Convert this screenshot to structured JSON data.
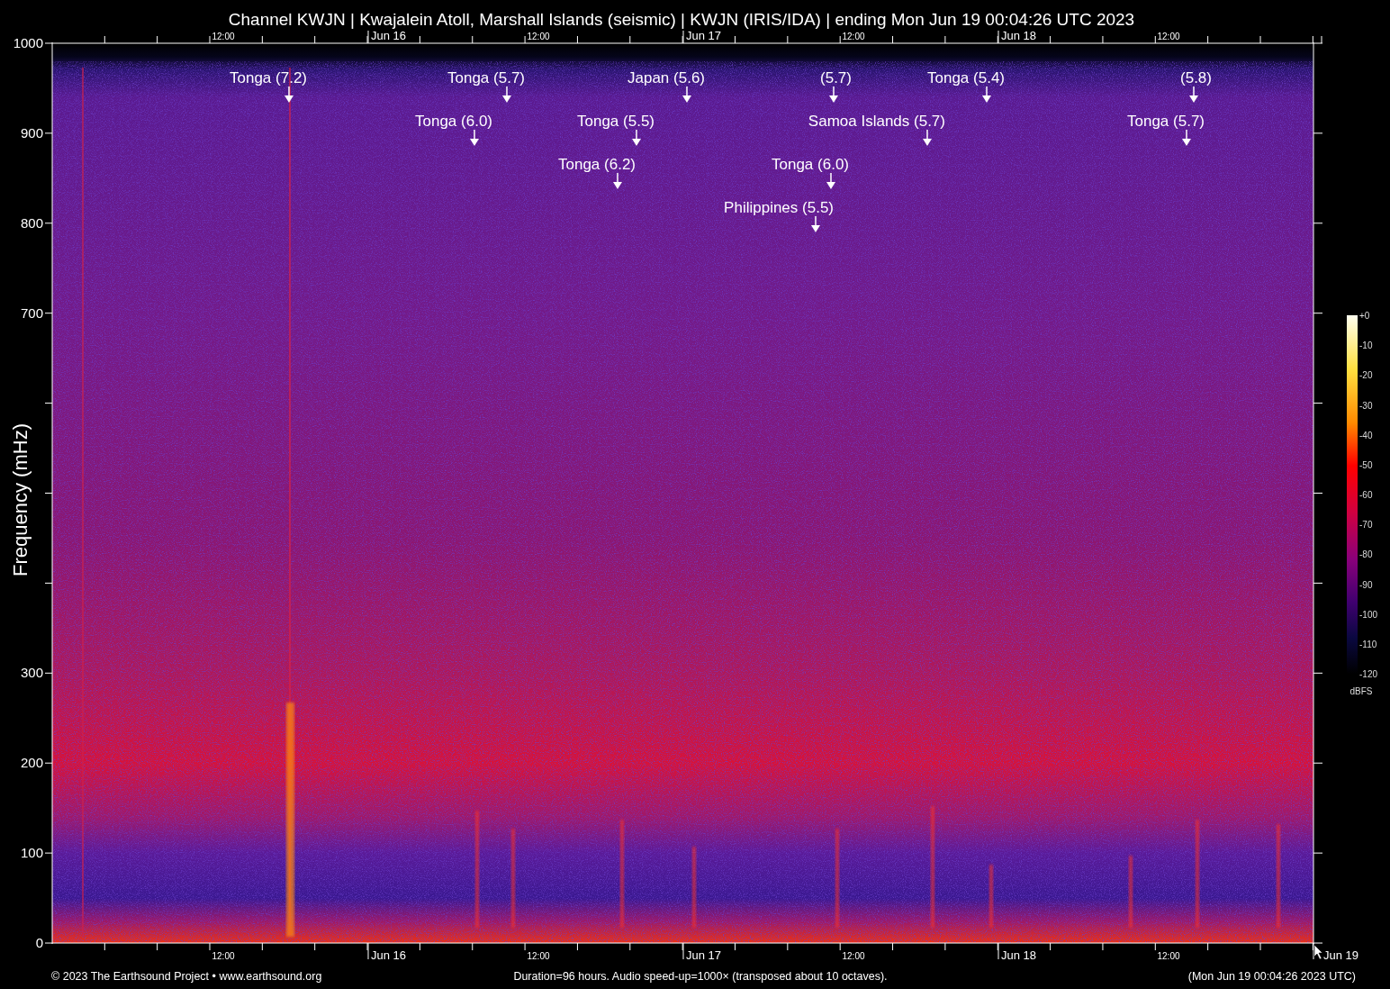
{
  "title": "Channel KWJN | Kwajalein Atoll, Marshall Islands (seismic) | KWJN (IRIS/IDA) | ending Mon Jun 19 00:04:26 UTC 2023",
  "y_axis": {
    "label": "Frequency (mHz)",
    "tick_labels": [
      "1000",
      "900",
      "800",
      "700",
      "300",
      "200",
      "100",
      "0"
    ]
  },
  "x_axis_top": [
    {
      "label": "12:00",
      "kind": "hour"
    },
    {
      "label": "Jun 16",
      "kind": "day"
    },
    {
      "label": "12:00",
      "kind": "hour"
    },
    {
      "label": "Jun 17",
      "kind": "day"
    },
    {
      "label": "12:00",
      "kind": "hour"
    },
    {
      "label": "Jun 18",
      "kind": "day"
    },
    {
      "label": "12:00",
      "kind": "hour"
    }
  ],
  "x_axis_bottom": [
    {
      "label": "12:00",
      "kind": "hour"
    },
    {
      "label": "Jun 16",
      "kind": "day"
    },
    {
      "label": "12:00",
      "kind": "hour"
    },
    {
      "label": "Jun 17",
      "kind": "day"
    },
    {
      "label": "12:00",
      "kind": "hour"
    },
    {
      "label": "Jun 18",
      "kind": "day"
    },
    {
      "label": "12:00",
      "kind": "hour"
    },
    {
      "label": "Jun 19",
      "kind": "day"
    }
  ],
  "events": [
    {
      "label": "Tonga (7.2)"
    },
    {
      "label": "Tonga (5.7)"
    },
    {
      "label": "Japan (5.6)"
    },
    {
      "label": "(5.7)"
    },
    {
      "label": "Tonga (5.4)"
    },
    {
      "label": "(5.8)"
    },
    {
      "label": "Tonga (6.0)"
    },
    {
      "label": "Tonga (5.5)"
    },
    {
      "label": "Samoa Islands (5.7)"
    },
    {
      "label": "Tonga (5.7)"
    },
    {
      "label": "Tonga (6.2)"
    },
    {
      "label": "Tonga (6.0)"
    },
    {
      "label": "Philippines (5.5)"
    }
  ],
  "colorbar": {
    "tick_labels": [
      "+0",
      "-10",
      "-20",
      "-30",
      "-40",
      "-50",
      "-60",
      "-70",
      "-80",
      "-90",
      "-100",
      "-110",
      "-120"
    ],
    "unit": "dBFS"
  },
  "footer": {
    "credit": "© 2023 The Earthsound Project • www.earthsound.org",
    "description": "Duration=96 hours. Audio speed-up=1000× (transposed about 10 octaves).",
    "timestamp": "(Mon Jun 19 00:04:26 2023 UTC)"
  }
}
